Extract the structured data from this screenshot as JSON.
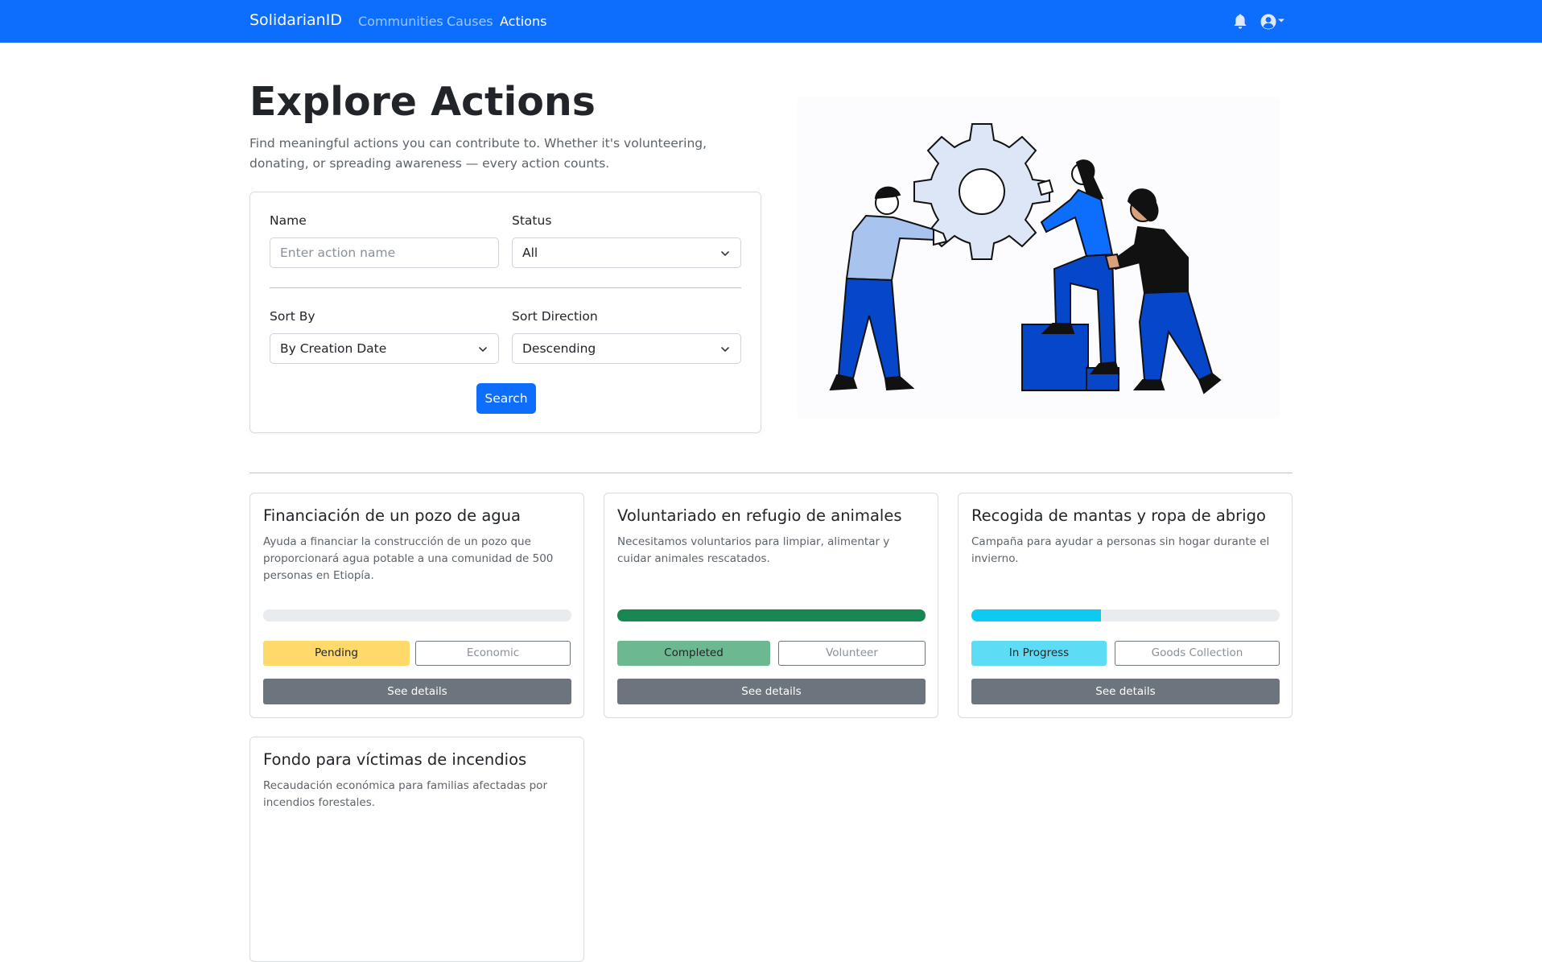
{
  "navbar": {
    "brand": "SolidarianID",
    "links": [
      {
        "label": "Communities",
        "active": false
      },
      {
        "label": "Causes",
        "active": false
      },
      {
        "label": "Actions",
        "active": true
      }
    ],
    "icons": [
      "bell-icon",
      "user-circle-icon"
    ]
  },
  "hero": {
    "title": "Explore Actions",
    "subtitle": "Find meaningful actions you can contribute to. Whether it's volunteering, donating, or spreading awareness — every action counts."
  },
  "filters": {
    "name_label": "Name",
    "name_placeholder": "Enter action name",
    "status_label": "Status",
    "status_value": "All",
    "sort_by_label": "Sort By",
    "sort_by_value": "By Creation Date",
    "sort_direction_label": "Sort Direction",
    "sort_direction_value": "Descending",
    "search_label": "Search"
  },
  "actions": [
    {
      "title": "Financiación de un pozo de agua",
      "description": "Ayuda a financiar la construcción de un pozo que proporcionará agua potable a una comunidad de 500 personas en Etiopía.",
      "progress": 0,
      "progress_color": "#e9ecef",
      "status": "Pending",
      "status_color": "#ffda6a",
      "type": "Economic",
      "details_label": "See details"
    },
    {
      "title": "Voluntariado en refugio de animales",
      "description": "Necesitamos voluntarios para limpiar, alimentar y cuidar animales rescatados.",
      "progress": 100,
      "progress_color": "#198754",
      "status": "Completed",
      "status_color": "#6cb891",
      "type": "Volunteer",
      "details_label": "See details"
    },
    {
      "title": "Recogida de mantas y ropa de abrigo",
      "description": "Campaña para ayudar a personas sin hogar durante el invierno.",
      "progress": 42,
      "progress_color": "#0dcaf0",
      "status": "In Progress",
      "status_color": "#5ddcf5",
      "type": "Goods Collection",
      "details_label": "See details"
    },
    {
      "title": "Fondo para víctimas de incendios",
      "description": "Recaudación económica para familias afectadas por incendios forestales."
    }
  ]
}
